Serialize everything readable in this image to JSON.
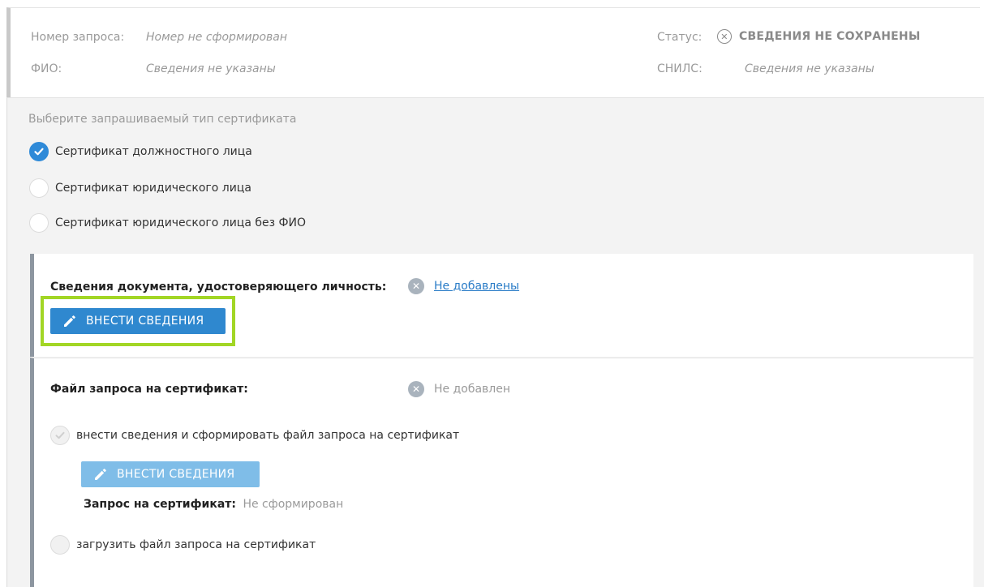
{
  "header": {
    "request_number_label": "Номер запроса:",
    "request_number_value": "Номер не сформирован",
    "fio_label": "ФИО:",
    "fio_value": "Сведения не указаны",
    "status_label": "Статус:",
    "status_value": "СВЕДЕНИЯ НЕ СОХРАНЕНЫ",
    "status_icon": "circle-x-icon",
    "snils_label": "СНИЛС:",
    "snils_value": "Сведения не указаны"
  },
  "certificate_type": {
    "prompt": "Выберите запрашиваемый тип сертификата",
    "options": [
      {
        "label": "Сертификат должностного лица",
        "selected": true
      },
      {
        "label": "Сертификат юридического лица",
        "selected": false
      },
      {
        "label": "Сертификат юридического лица без ФИО",
        "selected": false
      }
    ]
  },
  "identity_doc": {
    "label": "Сведения документа, удостоверяющего личность:",
    "status": "Не добавлены",
    "button_label": "ВНЕСТИ СВЕДЕНИЯ",
    "button_icon": "pencil-icon"
  },
  "request_file": {
    "label": "Файл запроса на сертификат:",
    "status": "Не добавлен",
    "option_generate": "внести сведения и сформировать файл запроса на сертификат",
    "generate_button_label": "ВНЕСТИ СВЕДЕНИЯ",
    "request_label": "Запрос на сертификат:",
    "request_value": "Не сформирован",
    "option_upload": "загрузить файл запроса на сертификат"
  },
  "colors": {
    "accent": "#2f88cf",
    "highlight": "#a2d625",
    "panel_border": "#8d96a0"
  }
}
